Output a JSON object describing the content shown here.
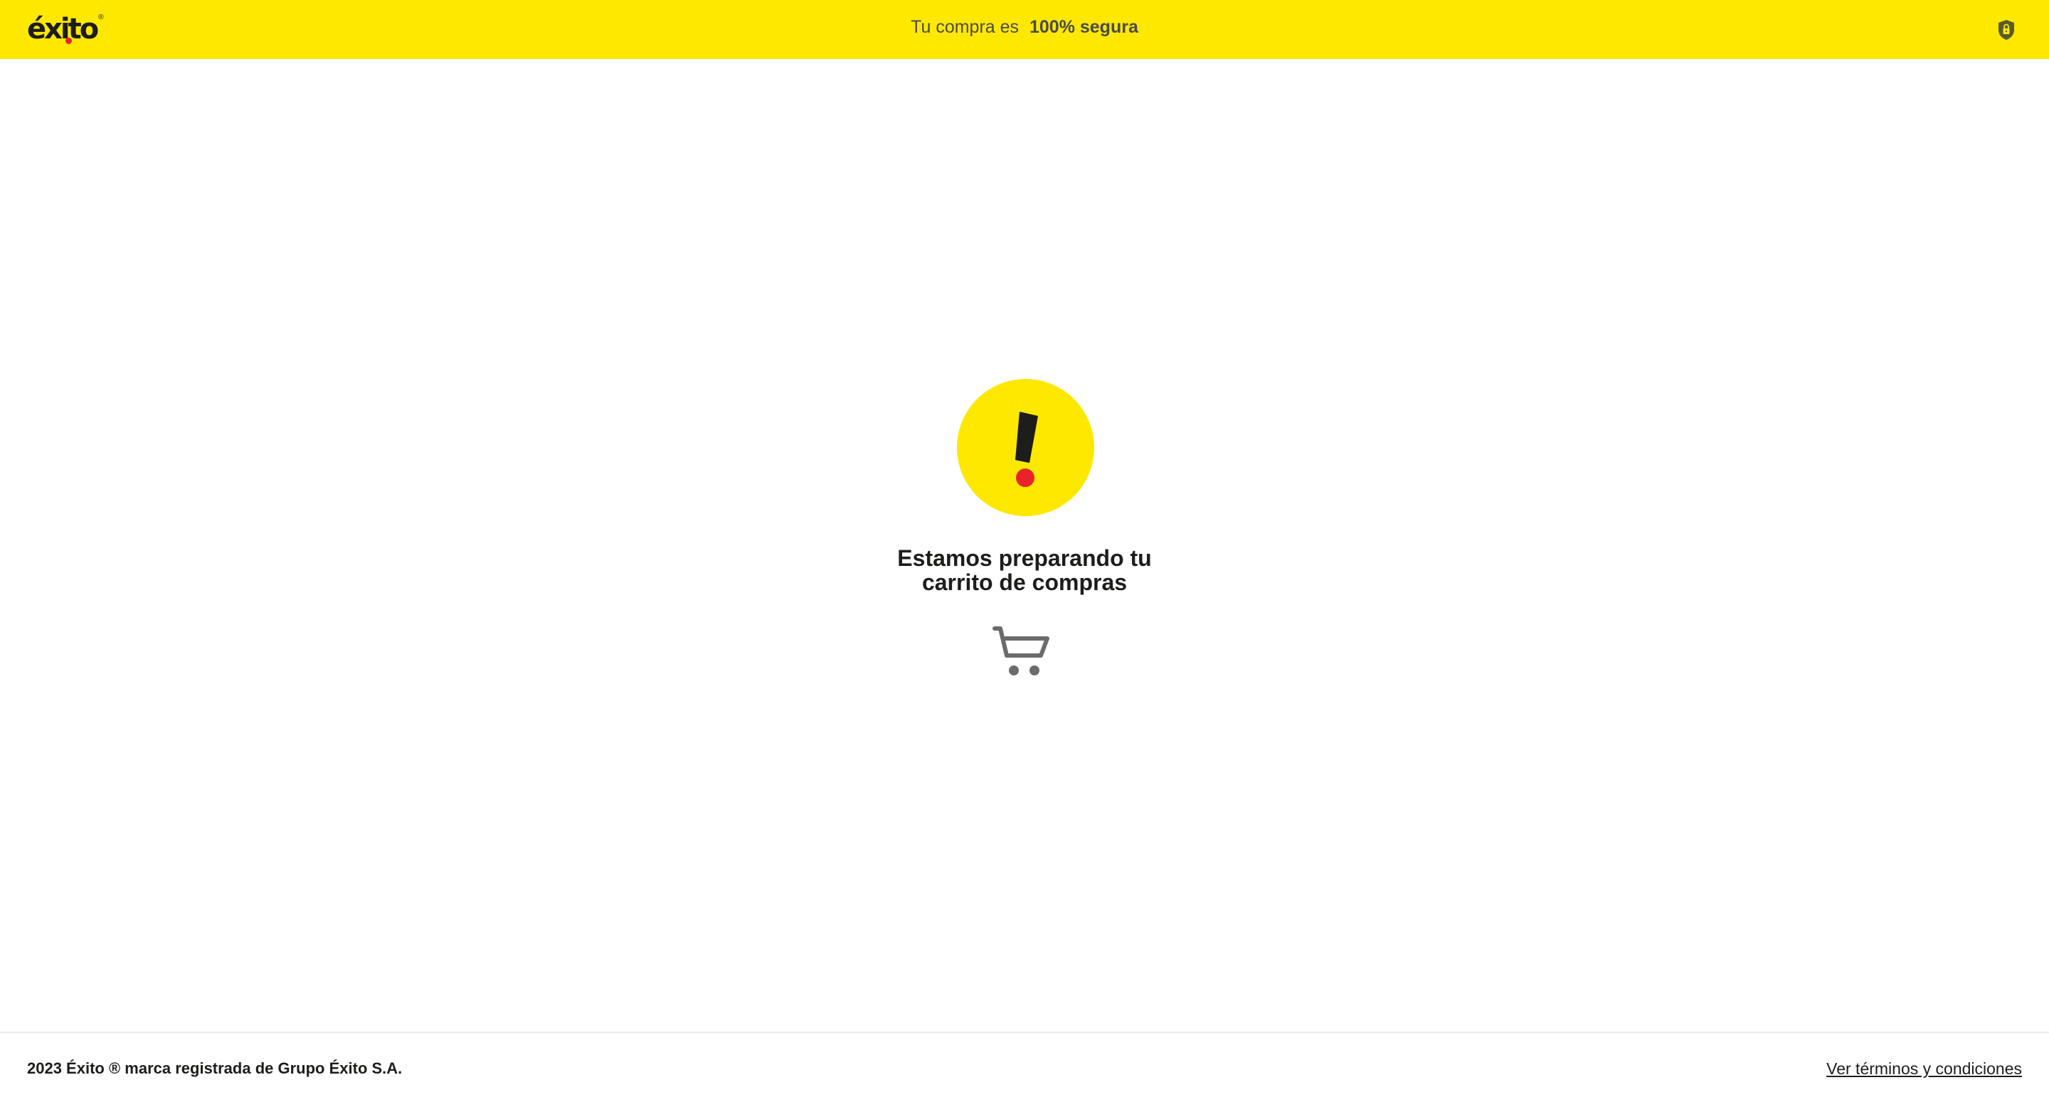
{
  "header": {
    "logo_text": "éxito",
    "logo_reg": "®",
    "secure_prefix": "Tu compra es",
    "secure_bold": "100% segura",
    "lock_icon": "lock-shield-icon",
    "background_color": "#ffe800"
  },
  "main": {
    "status_icon": "exclamation-icon",
    "title_line1": "Estamos preparando tu",
    "title_line2": "carrito de compras",
    "cart_icon": "shopping-cart-icon",
    "accent_yellow": "#ffe800",
    "accent_red": "#e8232a"
  },
  "footer": {
    "copyright": "2023 Éxito ® marca registrada de Grupo Éxito S.A.",
    "terms_link": "Ver términos y condiciones"
  }
}
